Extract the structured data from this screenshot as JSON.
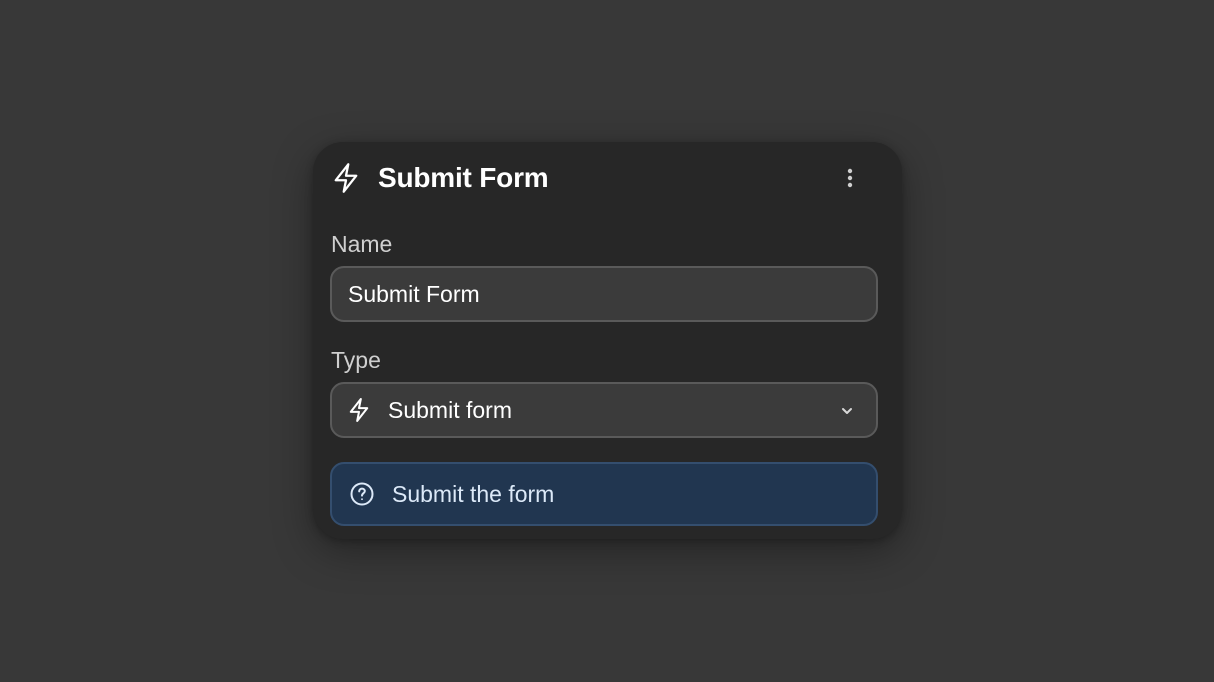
{
  "panel": {
    "title": "Submit Form",
    "title_icon": "lightning-bolt-icon",
    "menu_icon": "more-vertical-icon"
  },
  "fields": {
    "name": {
      "label": "Name",
      "value": "Submit Form"
    },
    "type": {
      "label": "Type",
      "selected": "Submit form",
      "icon": "lightning-bolt-icon",
      "dropdown_icon": "chevron-down-icon"
    }
  },
  "info": {
    "icon": "question-circle-icon",
    "text": "Submit the form"
  },
  "colors": {
    "background": "#383838",
    "panel": "#272727",
    "input_bg": "#3b3b3b",
    "input_border": "#5a5a5a",
    "info_bg": "#213650",
    "info_border": "#344e6e",
    "info_text": "#dce9f8"
  }
}
